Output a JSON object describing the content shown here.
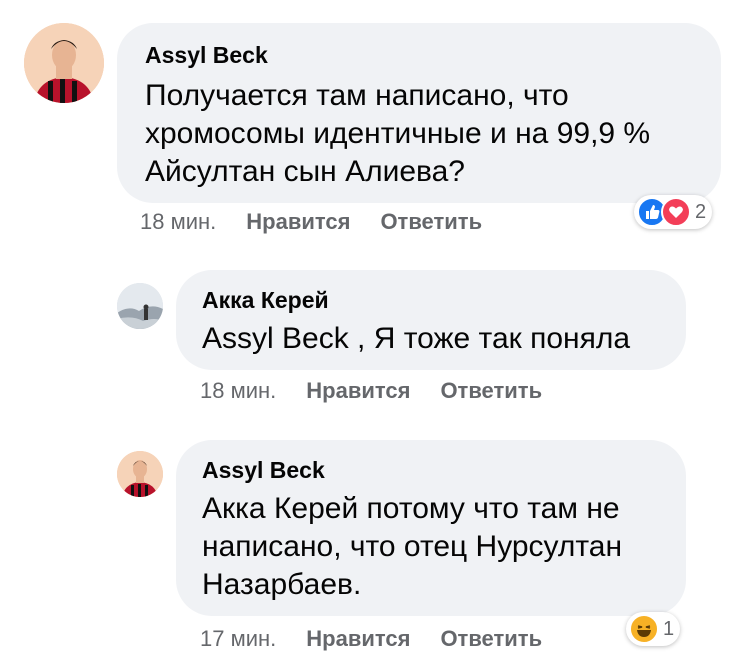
{
  "comments": [
    {
      "author": "Assyl Beck",
      "text": "Получается там написано, что\nхромосомы идентичные  и на 99,9 %\nАйсултан сын Алиева?",
      "time": "18 мин.",
      "like_label": "Нравится",
      "reply_label": "Ответить",
      "reactions": [
        "like-icon",
        "love-icon"
      ],
      "reaction_count": "2"
    },
    {
      "author": "Акка Керей",
      "text": "Assyl Beck , Я тоже так поняла",
      "time": "18 мин.",
      "like_label": "Нравится",
      "reply_label": "Ответить"
    },
    {
      "author": "Assyl Beck",
      "text": "Акка Керей потому что там не\nнаписано, что отец Нурсултан\nНазарбаев.",
      "time": "17 мин.",
      "like_label": "Нравится",
      "reply_label": "Ответить",
      "reactions": [
        "haha-icon"
      ],
      "reaction_count": "1"
    }
  ],
  "colors": {
    "bubble": "#f0f2f5",
    "meta_text": "#65676b",
    "like_blue": "#1877f2",
    "love_red": "#f33e58",
    "haha_yellow": "#f7b125"
  }
}
